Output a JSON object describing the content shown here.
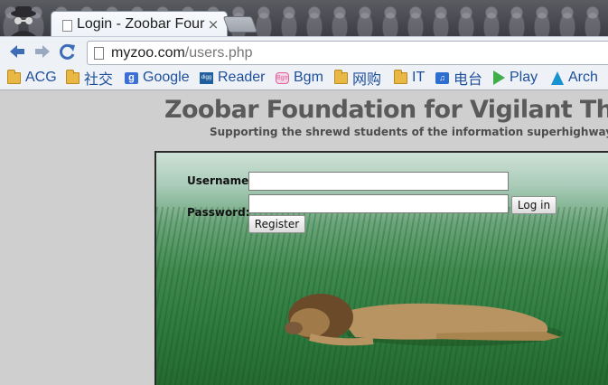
{
  "browser": {
    "tab": {
      "title": "Login - Zoobar Four",
      "close_glyph": "×"
    },
    "url": {
      "host": "myzoo.com",
      "path": "/users.php"
    },
    "nav": {
      "back_icon": "back-arrow-icon",
      "forward_icon": "forward-arrow-icon",
      "reload_icon": "reload-icon"
    },
    "bookmarks": [
      {
        "label": "ACG",
        "icon": "folder-icon"
      },
      {
        "label": "社交",
        "icon": "folder-icon"
      },
      {
        "label": "Google",
        "icon": "google-icon",
        "glyph": "g"
      },
      {
        "label": "Reader",
        "icon": "digg-icon",
        "glyph": "digg"
      },
      {
        "label": "Bgm",
        "icon": "bgm-icon",
        "glyph": "Bgm"
      },
      {
        "label": "网购",
        "icon": "folder-icon"
      },
      {
        "label": "IT",
        "icon": "folder-icon"
      },
      {
        "label": "电台",
        "icon": "calendar-icon",
        "glyph": "♫"
      },
      {
        "label": "Play",
        "icon": "play-store-icon"
      },
      {
        "label": "Arch",
        "icon": "arch-icon"
      }
    ]
  },
  "page": {
    "title": "Zoobar Foundation for Vigilant Thinking",
    "subtitle": "Supporting the shrewd students of the information superhighway",
    "login": {
      "username_label": "Username:",
      "password_label": "Password:",
      "username_value": "",
      "password_value": "",
      "login_button": "Log in",
      "register_button": "Register"
    },
    "hero_image": "lion-lying-in-grass"
  },
  "colors": {
    "bookmark_text": "#1e4f9b",
    "page_background": "#cfcfcf",
    "title_text": "#5a5a5a"
  }
}
